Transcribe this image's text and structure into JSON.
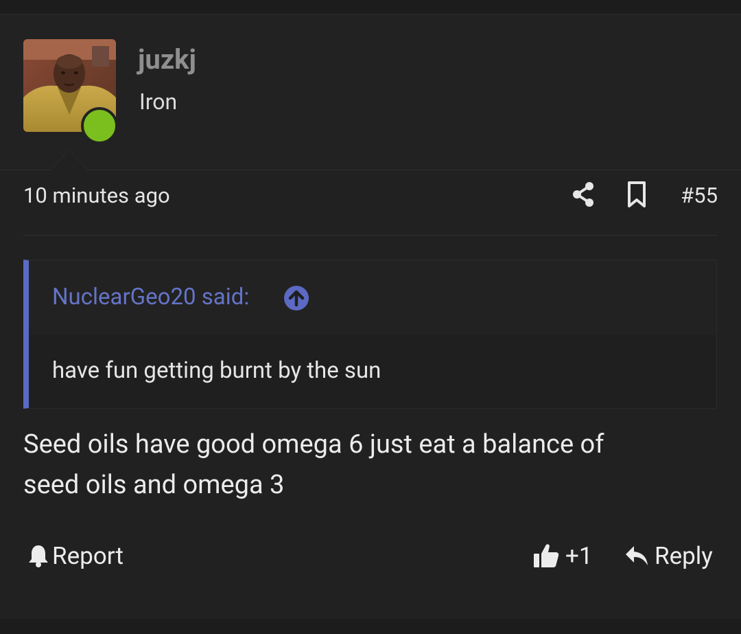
{
  "colors": {
    "background": "#1a1a1a",
    "post_background": "#212121",
    "accent": "#5c6ac4",
    "online": "#7bbf1f",
    "username": "#8f8f8f"
  },
  "user": {
    "name": "juzkj",
    "title": "Iron",
    "avatar_icon": "user-avatar-photo",
    "online_indicator_icon": "online-status-dot"
  },
  "meta": {
    "timestamp": "10 minutes ago",
    "share_icon": "share-icon",
    "bookmark_icon": "bookmark-icon",
    "post_number": "#55"
  },
  "quote": {
    "author": "NuclearGeo20 said:",
    "jump_icon": "arrow-up-circle-icon",
    "text": "have fun getting burnt by the sun"
  },
  "message": {
    "line1": "Seed oils have good omega 6 just eat a balance of",
    "line2": "seed oils and omega 3"
  },
  "actions": {
    "report_label": "Report",
    "report_icon": "bell-icon",
    "like_label": "+1",
    "like_icon": "thumbs-up-icon",
    "reply_label": "Reply",
    "reply_icon": "reply-arrow-icon"
  }
}
